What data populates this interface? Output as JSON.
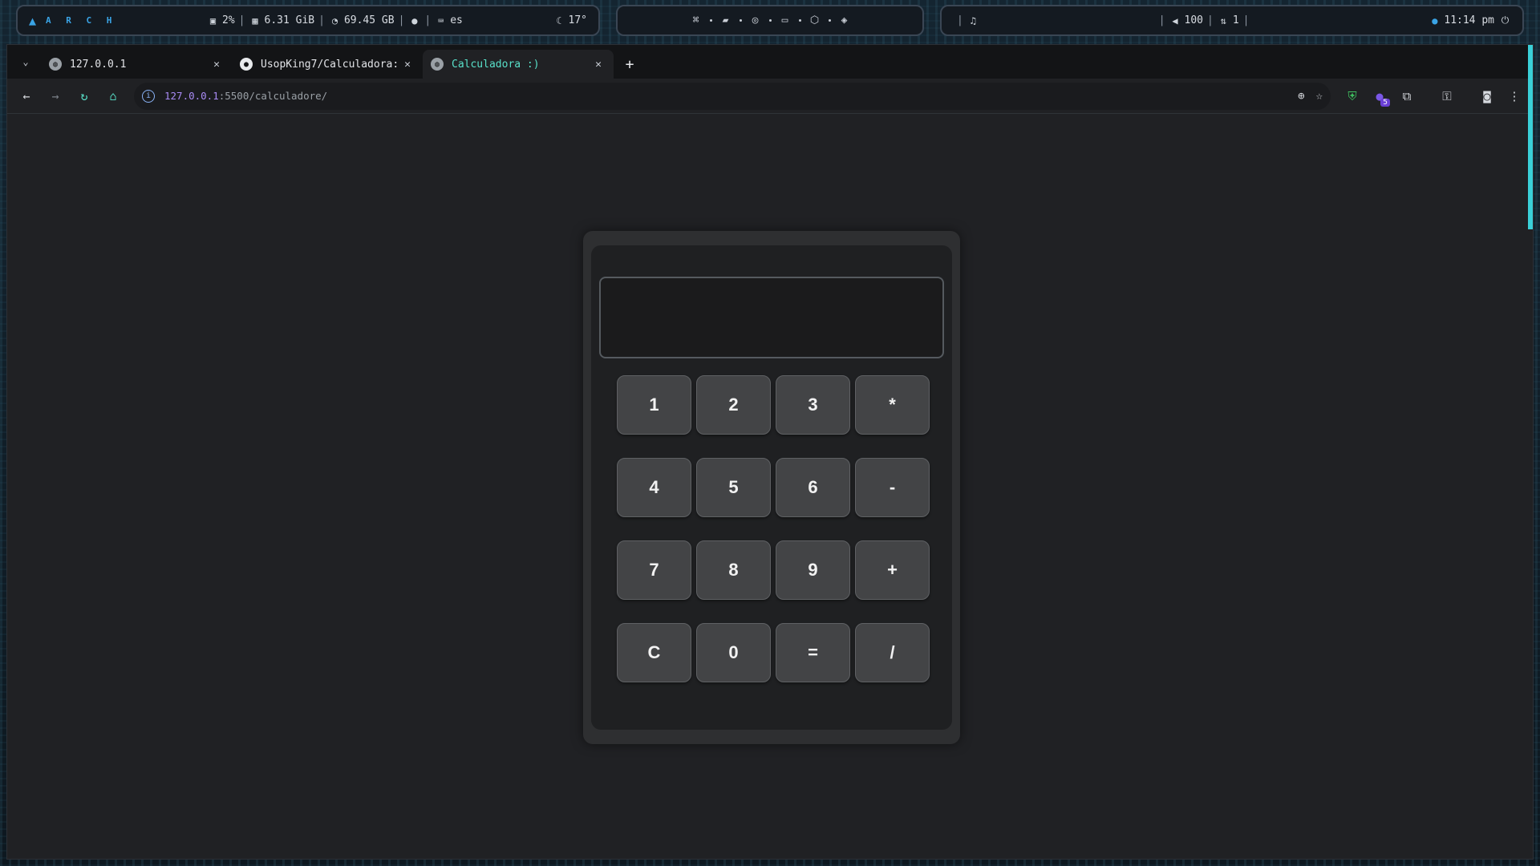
{
  "topbar": {
    "left": {
      "arch_letters": "A R C H",
      "cpu": "2%",
      "ram": "6.31 GiB",
      "disk": "69.45 GB",
      "keyboard_layout": "es",
      "weather_temp": "17°",
      "separator": "|"
    },
    "right": {
      "separator": "|",
      "volume": "100",
      "updates": "1",
      "clock": "11:14 pm"
    }
  },
  "browser": {
    "tabs": [
      {
        "title": "127.0.0.1",
        "active": false
      },
      {
        "title": "UsopKing7/Calculadora:",
        "active": false
      },
      {
        "title": "Calculadora :)",
        "active": true
      }
    ],
    "close_symbol": "✕",
    "newtab_symbol": "+",
    "url_host": "127.0.0.1",
    "url_rest": ":5500/calculadore/",
    "extension_badge": "5"
  },
  "calculator": {
    "display_value": "",
    "keys": [
      "1",
      "2",
      "3",
      "*",
      "4",
      "5",
      "6",
      "-",
      "7",
      "8",
      "9",
      "+",
      "C",
      "0",
      "=",
      "/"
    ]
  },
  "colors": {
    "accent": "#58e0c9",
    "url_host": "#a98bf5",
    "key_bg": "#434446",
    "page_bg": "#202124"
  }
}
